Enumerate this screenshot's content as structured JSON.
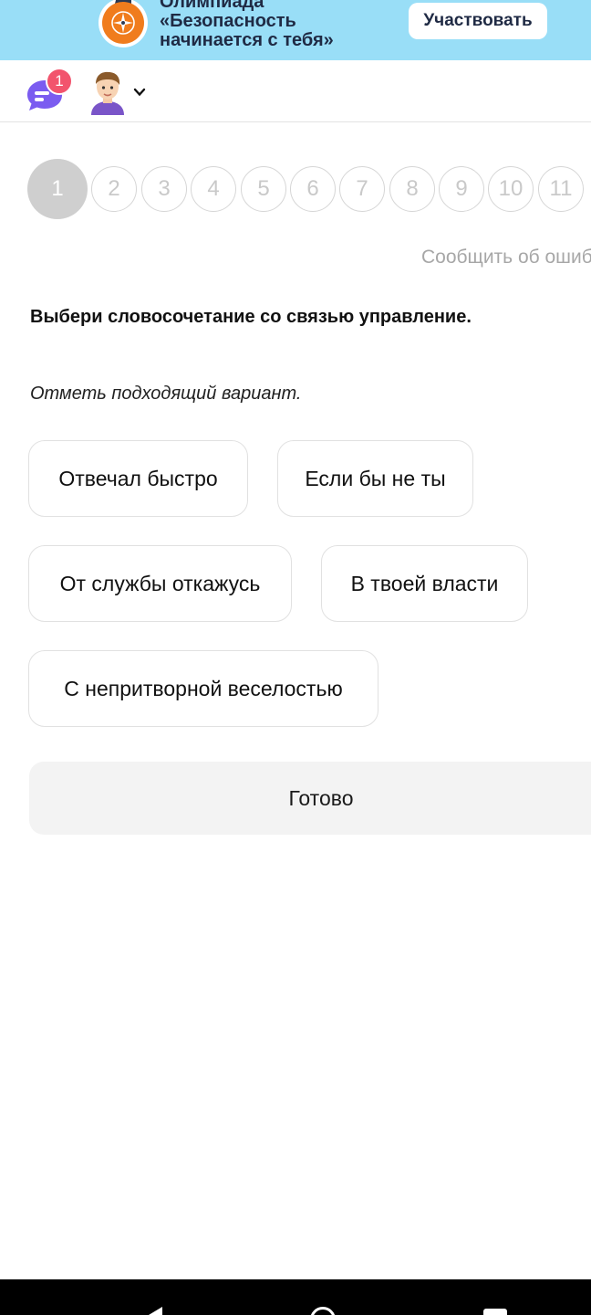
{
  "banner": {
    "title_lines": [
      "Олимпиада",
      "«Безопасность",
      "начинается с тебя»"
    ],
    "cta_label": "Участвовать",
    "background": "#99def7",
    "logo_icon": "compass-logo-icon"
  },
  "header": {
    "chat_icon": "chat-bubble-icon",
    "chat_badge_count": "1",
    "avatar_icon": "boy-avatar-icon",
    "dropdown_icon": "chevron-down-icon"
  },
  "steps": {
    "items": [
      "1",
      "2",
      "3",
      "4",
      "5",
      "6",
      "7",
      "8",
      "9",
      "10",
      "11"
    ],
    "current": "1"
  },
  "report_link": "Сообщить об ошибке",
  "question": "Выбери словосочетание со связью управление.",
  "instruction": "Отметь подходящий вариант.",
  "options": [
    "Отвечал быстро",
    "Если бы не ты",
    "От службы откажусь",
    "В твоей власти",
    "С непритворной веселостью"
  ],
  "done_label": "Готово",
  "system_nav": {
    "back_icon": "back-triangle-icon",
    "home_icon": "home-circle-icon",
    "recents_icon": "recents-square-icon"
  },
  "colors": {
    "accent_badge": "#f2546d",
    "chat_purple": "#7b5cf0",
    "logo_orange": "#f07c1d",
    "step_active": "#cfcfcf",
    "done_button_bg": "#f3f3f3"
  }
}
